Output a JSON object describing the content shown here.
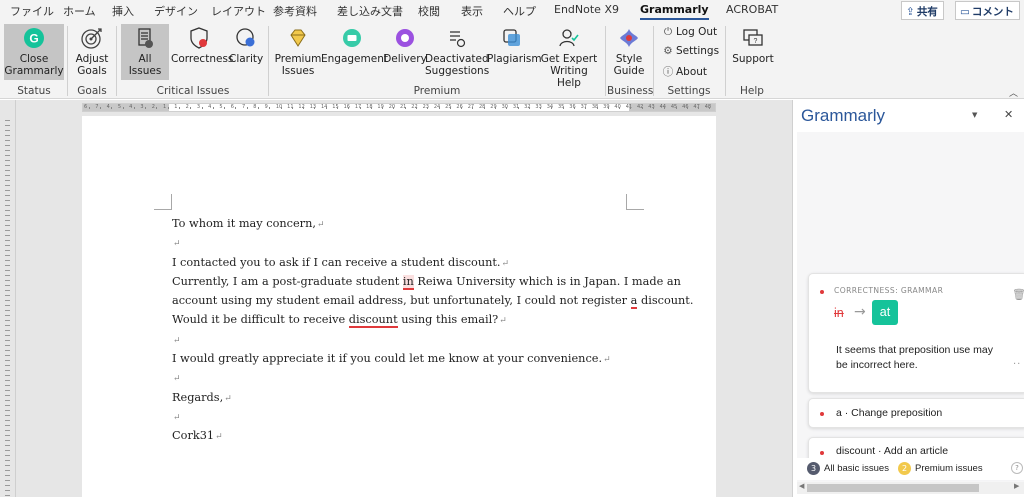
{
  "tabs": [
    "ファイル",
    "ホーム",
    "挿入",
    "デザイン",
    "レイアウト",
    "参考資料",
    "差し込み文書",
    "校閲",
    "表示",
    "ヘルプ",
    "EndNote X9",
    "Grammarly",
    "ACROBAT"
  ],
  "active_tab": "Grammarly",
  "share_label": "共有",
  "comment_label": "コメント",
  "ribbon": {
    "close_grammarly": "Close Grammarly",
    "adjust_goals": "Adjust Goals",
    "all_issues": "All Issues",
    "correctness": "Correctness",
    "clarity": "Clarity",
    "premium_issues": "Premium Issues",
    "engagement": "Engagement",
    "delivery": "Delivery",
    "deactivated_suggestions": "Deactivated Suggestions",
    "plagiarism": "Plagiarism",
    "get_expert_writing_help": "Get Expert Writing Help",
    "style_guide": "Style Guide",
    "log_out": "Log Out",
    "settings": "Settings",
    "about": "About",
    "support": "Support"
  },
  "groups": [
    "Status",
    "Goals",
    "Critical Issues",
    "Premium",
    "Business",
    "Settings",
    "Help"
  ],
  "ruler_numbers": [
    "6",
    "7",
    "4",
    "5",
    "4",
    "3",
    "2",
    "1",
    "1",
    "2",
    "3",
    "4",
    "5",
    "6",
    "7",
    "8",
    "9",
    "10",
    "11",
    "12",
    "13",
    "14",
    "15",
    "16",
    "17",
    "18",
    "19",
    "20",
    "21",
    "22",
    "23",
    "24",
    "25",
    "26",
    "27",
    "28",
    "29",
    "30",
    "31",
    "32",
    "33",
    "34",
    "35",
    "36",
    "37",
    "38",
    "39",
    "40",
    "41",
    "42",
    "43",
    "44",
    "45",
    "46",
    "47",
    "48"
  ],
  "document": {
    "salutation": "To whom it may concern,",
    "line_request": "I contacted you to ask if I can receive a student discount.",
    "p2_l1_a": "Currently, I am a post-graduate student ",
    "p2_l1_err": "in",
    "p2_l1_b": " Reiwa University which is in Japan. I made an",
    "p2_l2_a": "account using my student email address, but unfortunately, I could not register ",
    "p2_l2_err": "a",
    "p2_l2_b": " discount.",
    "p2_l3_a": "Would it be difficult to receive ",
    "p2_l3_err": "discount",
    "p2_l3_b": " using this email?",
    "line_appreciate": "I would greatly appreciate it if you could let me know at your convenience.",
    "closing": "Regards,",
    "signature": "Cork31",
    "pilcrow": "↵"
  },
  "panel": {
    "title": "Grammarly",
    "card": {
      "category": "CORRECTNESS: GRAMMAR",
      "original": "in",
      "replacement": "at",
      "explanation": "It seems that preposition use may be incorrect here."
    },
    "suggestions": [
      "a  ·  Change preposition",
      "discount  ·  Add an article"
    ],
    "footer": {
      "basic_count": "3",
      "basic_label": "All basic issues",
      "premium_count": "2",
      "premium_label": "Premium issues"
    }
  },
  "colors": {
    "accent": "#2b579a",
    "error": "#e0393b",
    "grammarly_green": "#15c39a",
    "premium_yellow": "#f2c94c"
  }
}
